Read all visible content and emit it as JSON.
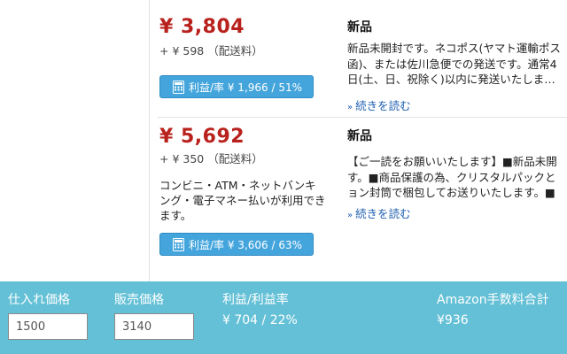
{
  "offers": [
    {
      "price": "¥ 3,804",
      "shipping": "+ ¥ 598 （配送料）",
      "pay_note": "",
      "profit_button": "利益/率 ¥ 1,966 / 51%",
      "condition": "新品",
      "desc_lines": [
        "新品未開封です。ネコポス(ヤマト運輸ポス",
        "函)、または佐川急便での発送です。通常4",
        "日(土、日、祝除く)以内に発送いたしま…"
      ],
      "more_link": "続きを読む"
    },
    {
      "price": "¥ 5,692",
      "shipping": "+ ¥ 350 （配送料）",
      "pay_note": "コンビニ・ATM・ネットバンキング・電子マネー払いが利用できます。",
      "profit_button": "利益/率 ¥ 3,606 / 63%",
      "condition": "新品",
      "desc_lines": [
        "【ご一読をお願いいたします】■新品未開",
        "す。■商品保護の為、クリスタルパックと",
        "ョン封筒で梱包してお送りいたします。■"
      ],
      "more_link": "続きを読む"
    }
  ],
  "footer": {
    "purchase_price_label": "仕入れ価格",
    "purchase_price_value": "1500",
    "sale_price_label": "販売価格",
    "sale_price_value": "3140",
    "profit_label": "利益/利益率",
    "profit_value": "¥ 704 / 22%",
    "fee_label": "Amazon手数料合計",
    "fee_value": "¥936"
  },
  "colors": {
    "price": "#b8211c",
    "button": "#44a5dc",
    "footer": "#64c0d6",
    "link": "#1f5fb0"
  }
}
